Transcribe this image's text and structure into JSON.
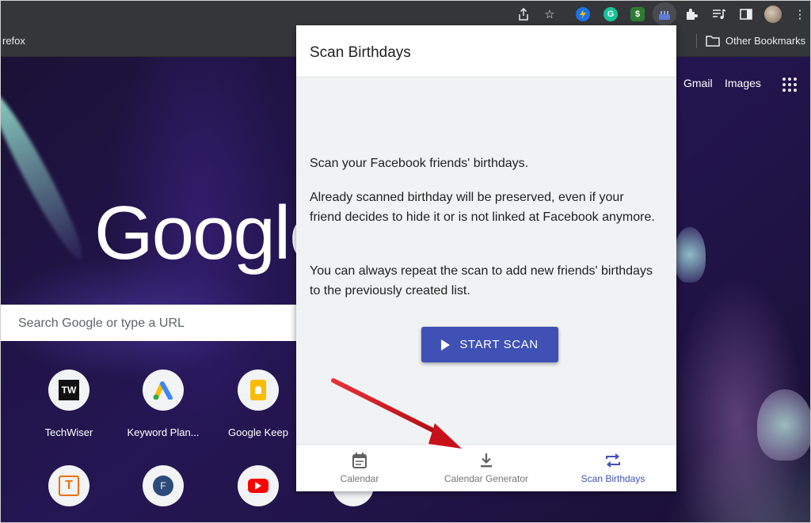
{
  "browser": {
    "bookmark_left": "refox",
    "other_bookmarks": "Other Bookmarks",
    "extensions": [
      {
        "name": "lightning-icon",
        "color": "#1a73e8"
      },
      {
        "name": "grammarly-icon",
        "color": "#15c39a",
        "letter": "G"
      },
      {
        "name": "dollar-icon",
        "color": "#2e7d32",
        "letter": "$"
      },
      {
        "name": "birthday-cake-icon",
        "color": "#5b7bd5"
      }
    ]
  },
  "google_page": {
    "logo_text": "Google",
    "links": {
      "gmail": "Gmail",
      "images": "Images"
    },
    "search_placeholder": "Search Google or type a URL",
    "shortcuts": [
      {
        "label": "TechWiser",
        "icon": "techwiser-icon",
        "glyph": "TW"
      },
      {
        "label": "Keyword Plan...",
        "icon": "google-ads-icon"
      },
      {
        "label": "Google Keep",
        "icon": "google-keep-icon"
      }
    ]
  },
  "popup": {
    "title": "Scan Birthdays",
    "para1": "Scan your Facebook friends' birthdays.",
    "para2": "Already scanned birthday will be preserved, even if your friend decides to hide it or is not linked at Facebook anymore.",
    "para3": "You can always repeat the scan to add new friends' birthdays to the previously created list.",
    "start_button": "START SCAN",
    "accent_color": "#3f51b5",
    "nav": [
      {
        "label": "Calendar",
        "icon": "calendar-icon",
        "active": false
      },
      {
        "label": "Calendar Generator",
        "icon": "download-icon",
        "active": false
      },
      {
        "label": "Scan Birthdays",
        "icon": "repeat-icon",
        "active": true
      }
    ]
  },
  "annotation": {
    "arrow_color": "#d0121b"
  }
}
